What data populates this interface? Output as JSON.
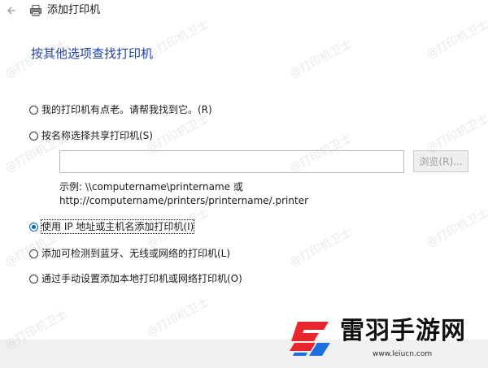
{
  "window": {
    "title": "添加打印机"
  },
  "heading": "按其他选项查找打印机",
  "options": [
    {
      "label": "我的打印机有点老。请帮我找到它。(R)",
      "checked": false
    },
    {
      "label": "按名称选择共享打印机(S)",
      "checked": false
    },
    {
      "label": "使用 IP 地址或主机名添加打印机(I)",
      "checked": true
    },
    {
      "label": "添加可检测到蓝牙、无线或网络的打印机(L)",
      "checked": false
    },
    {
      "label": "通过手动设置添加本地打印机或网络打印机(O)",
      "checked": false
    }
  ],
  "shared_printer": {
    "input_value": "",
    "browse_label": "浏览(R)...",
    "example_line1": "示例: \\\\computername\\printername 或",
    "example_line2": "http://computername/printers/printername/.printer"
  },
  "watermark_text": "@打印机卫士",
  "brand": {
    "name": "雷羽手游网",
    "url": "www.leiucn.com"
  },
  "colors": {
    "heading": "#1f3f9e",
    "radio_selected": "#0067c0",
    "footer_bg": "#f0f0f0",
    "brand_red": "#e8272d",
    "brand_blue": "#1d6fe0"
  }
}
